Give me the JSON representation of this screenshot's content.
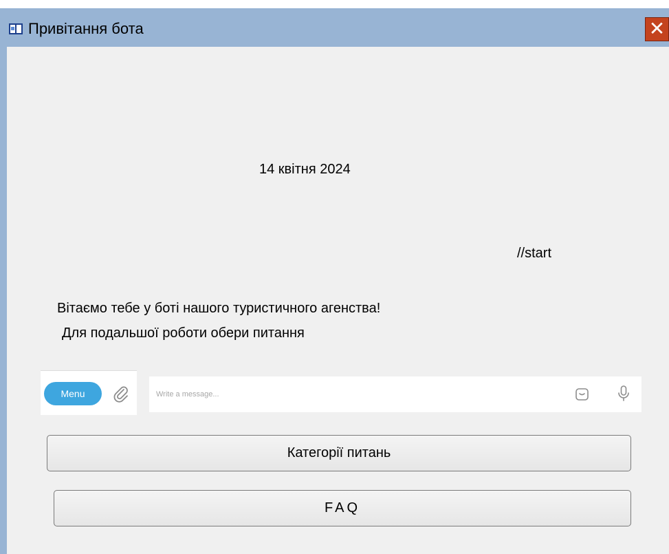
{
  "window": {
    "title": "Привітання бота",
    "close_label": "✕"
  },
  "chat": {
    "date": "14 квітня 2024",
    "command": "//start",
    "welcome_line1": "Вітаємо тебе у боті нашого туристичного агенства!",
    "welcome_line2": "Для подальшої роботи обери питання"
  },
  "input_bar": {
    "menu_label": "Menu",
    "placeholder": "Write a message...",
    "icons": [
      "paperclip-icon",
      "sticker-icon",
      "microphone-icon"
    ]
  },
  "keyboard": {
    "buttons": [
      {
        "label": "Категорії питань"
      },
      {
        "label": "FAQ"
      }
    ]
  },
  "colors": {
    "titlebar": "#98b4d4",
    "close_button": "#c4431e",
    "menu_button": "#3ea6df",
    "background": "#f0f0f0"
  }
}
